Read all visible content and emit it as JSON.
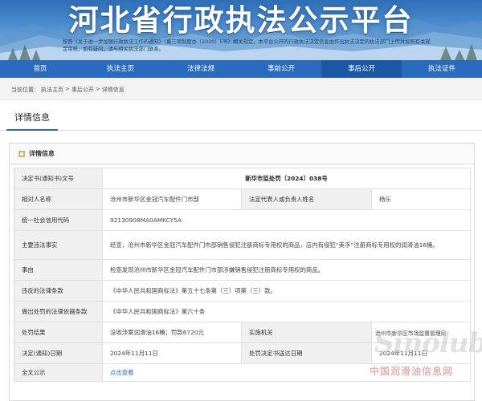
{
  "banner": {
    "title": "河北省行政执法公示平台",
    "notice": "按照《关于进一步加强行政执法工作的通知》（冀三项制度办〔2020〕5号）相关规定，本平台公开的行政执法决定信息由作出执法决定的执法部门上传并按照有关规定审核，如有疑问，请与相关执法部门联系。"
  },
  "nav": {
    "items": [
      "首页",
      "执法主页",
      "法律法规",
      "事前公开",
      "事后公开",
      "执法证件"
    ],
    "active_index": 4
  },
  "breadcrumb": {
    "prefix": "当前位置：",
    "items": [
      "执法主页",
      "事后公开",
      "详情信息"
    ],
    "separator": ">"
  },
  "tab": {
    "label": "详情信息"
  },
  "panel": {
    "title": "详情信息",
    "rows": {
      "decision_no": {
        "label": "决定书(通知书)文号",
        "value": "新华市监处罚〔2024〕038号"
      },
      "party": {
        "label": "相对人名称",
        "value": "沧州市新华区金冠汽车配件门市部",
        "label2": "法定代表人或负责人姓名",
        "value2": "杨乐"
      },
      "credit_code": {
        "label": "统一社会信用代码",
        "value": "92130908MA0AMKCY5A"
      },
      "facts": {
        "label": "主要违法事实",
        "value": "经查，沧州市新华区金冠汽车配件门市部销售侵犯注册商标专用权的商品，店内有侵犯“美孚”注册商标专用权的润滑油16桶。"
      },
      "cause": {
        "label": "事由",
        "value": "检查发现沧州市新华区金冠汽车配件门市部涉嫌销售侵犯注册商标专用权的商品。"
      },
      "violated_law": {
        "label": "违反的法律条款",
        "value": "《中华人民共和国商标法》第五十七条第（三）项第（三）款。"
      },
      "basis": {
        "label": "做出处罚的法律依据条款",
        "value": "《中华人民共和国商标法》第六十条"
      },
      "result": {
        "label": "处罚结果",
        "value": "没收涉案润滑油16桶；罚款6720元",
        "label2": "实施机关",
        "value2": "沧州市新华区市场监督管理局"
      },
      "decision_date": {
        "label": "决定(通知)日期",
        "value": "2024年11月11日",
        "label2": "处罚决定书送达日期",
        "value2": "2024年11月11日"
      },
      "full_text": {
        "label": "全文公示",
        "link": "点击查看"
      }
    }
  },
  "watermark": {
    "logo": "Sinolub",
    "text": "中国润滑油信息网"
  },
  "colors": {
    "nav": "#2a6bbf",
    "nav_active": "#1b58a6",
    "link": "#2a6bbf",
    "accent": "#e2b06a"
  }
}
